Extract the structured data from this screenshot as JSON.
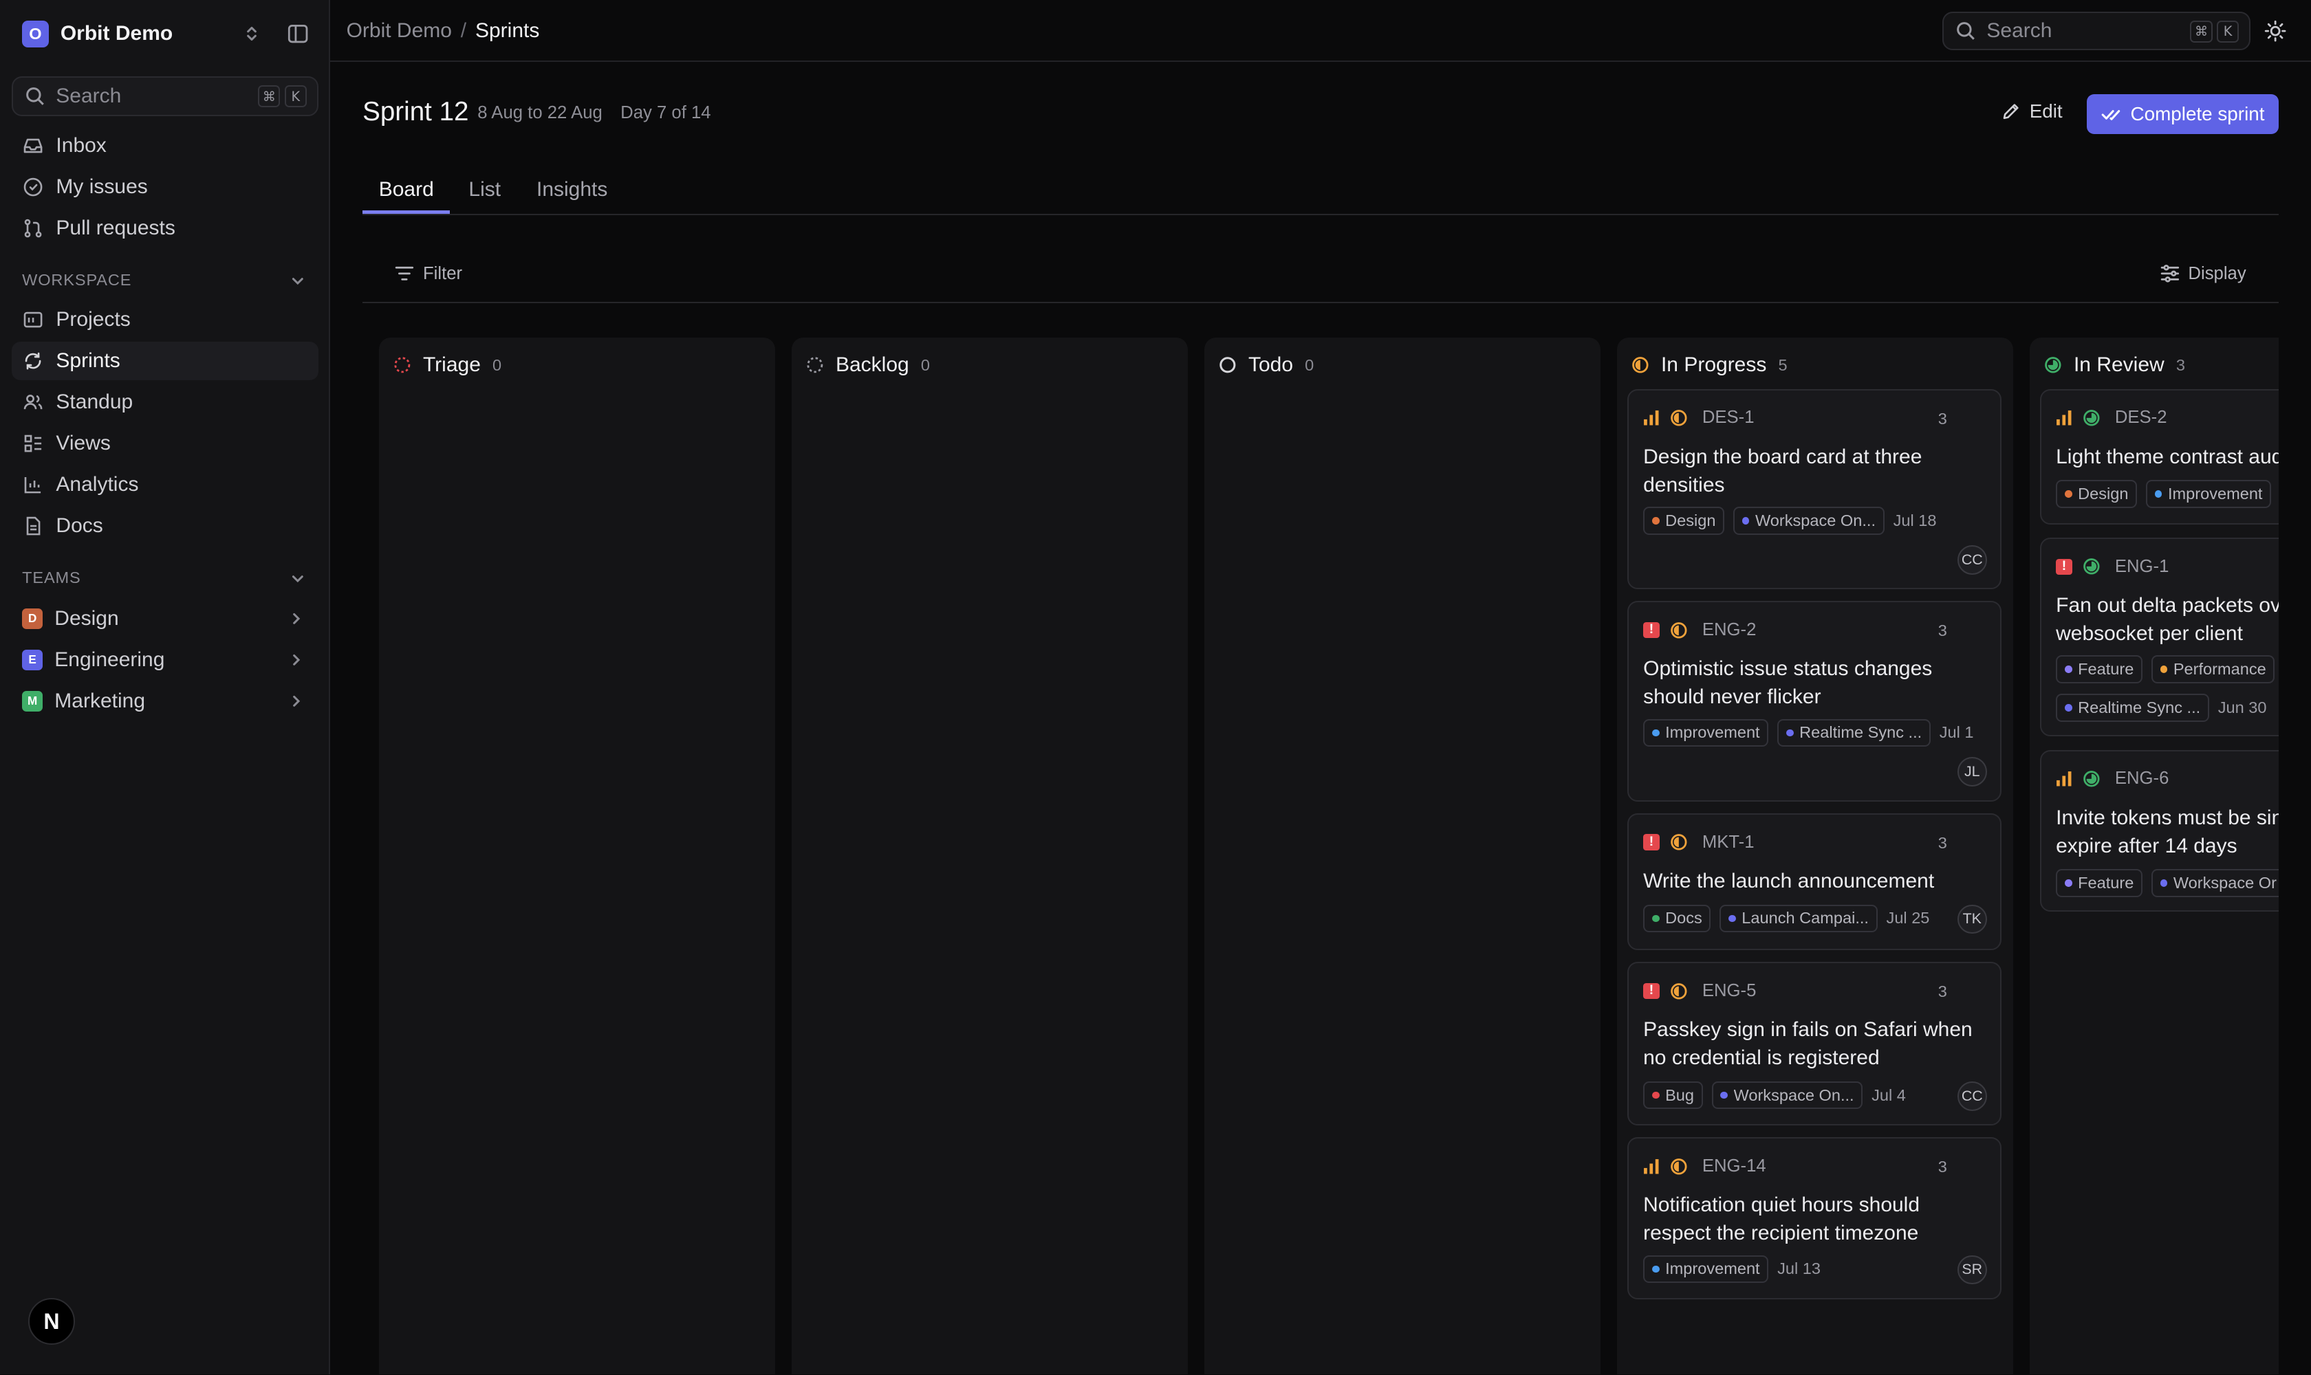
{
  "workspace": {
    "name": "Orbit Demo",
    "logo_letter": "O"
  },
  "sidebar": {
    "search_placeholder": "Search",
    "shortcut": [
      "⌘",
      "K"
    ],
    "nav": [
      {
        "label": "Inbox",
        "icon": "inbox-icon"
      },
      {
        "label": "My issues",
        "icon": "my-issues-icon"
      },
      {
        "label": "Pull requests",
        "icon": "pull-request-icon"
      }
    ],
    "workspace_section": "WORKSPACE",
    "workspace_items": [
      {
        "label": "Projects",
        "icon": "projects-icon"
      },
      {
        "label": "Sprints",
        "icon": "sprints-icon",
        "active": true
      },
      {
        "label": "Standup",
        "icon": "standup-icon"
      },
      {
        "label": "Views",
        "icon": "views-icon"
      },
      {
        "label": "Analytics",
        "icon": "analytics-icon"
      },
      {
        "label": "Docs",
        "icon": "docs-icon"
      }
    ],
    "teams_section": "TEAMS",
    "teams": [
      {
        "label": "Design",
        "letter": "D",
        "color": "#c4623d"
      },
      {
        "label": "Engineering",
        "letter": "E",
        "color": "#5f63e6"
      },
      {
        "label": "Marketing",
        "letter": "M",
        "color": "#3fae68"
      }
    ],
    "user_avatar": "N"
  },
  "topbar": {
    "breadcrumb_root": "Orbit Demo",
    "breadcrumb_sep": "/",
    "breadcrumb_current": "Sprints",
    "search_placeholder": "Search",
    "shortcut": [
      "⌘",
      "K"
    ]
  },
  "sprint": {
    "title": "Sprint 12",
    "dates": "8 Aug to 22 Aug",
    "day": "Day 7 of 14",
    "edit_label": "Edit",
    "complete_label": "Complete sprint"
  },
  "tabs": [
    "Board",
    "List",
    "Insights"
  ],
  "toolbar": {
    "filter_label": "Filter",
    "display_label": "Display"
  },
  "colors": {
    "accent": "#5f63e6",
    "urgent": "#e5484d",
    "in_progress": "#f0a23b",
    "in_review": "#3fae68"
  },
  "columns": [
    {
      "name": "Triage",
      "count": "0",
      "status": "triage",
      "cards": []
    },
    {
      "name": "Backlog",
      "count": "0",
      "status": "backlog",
      "cards": []
    },
    {
      "name": "Todo",
      "count": "0",
      "status": "todo",
      "cards": []
    },
    {
      "name": "In Progress",
      "count": "5",
      "status": "in-progress",
      "cards": [
        {
          "id": "DES-1",
          "priority": "medium",
          "estimate": "3",
          "title": "Design the board card at three densities",
          "labels": [
            {
              "text": "Design",
              "color": "#e0743d"
            }
          ],
          "project": {
            "text": "Workspace On...",
            "color": "#6b6ef0"
          },
          "due": "Jul 18",
          "assignee": "CC"
        },
        {
          "id": "ENG-2",
          "priority": "urgent",
          "estimate": "3",
          "title": "Optimistic issue status changes should never flicker",
          "labels": [
            {
              "text": "Improvement",
              "color": "#4a9cf0"
            }
          ],
          "project": {
            "text": "Realtime Sync ...",
            "color": "#6b6ef0"
          },
          "due": "Jul 1",
          "assignee": "JL"
        },
        {
          "id": "MKT-1",
          "priority": "urgent",
          "estimate": "3",
          "title": "Write the launch announcement",
          "labels": [
            {
              "text": "Docs",
              "color": "#3fae68"
            }
          ],
          "project": {
            "text": "Launch Campai...",
            "color": "#6b6ef0"
          },
          "due": "Jul 25",
          "assignee": "TK"
        },
        {
          "id": "ENG-5",
          "priority": "urgent",
          "estimate": "3",
          "title": "Passkey sign in fails on Safari when no credential is registered",
          "labels": [
            {
              "text": "Bug",
              "color": "#e5484d"
            }
          ],
          "project": {
            "text": "Workspace On...",
            "color": "#6b6ef0"
          },
          "due": "Jul 4",
          "assignee": "CC"
        },
        {
          "id": "ENG-14",
          "priority": "medium",
          "estimate": "3",
          "title": "Notification quiet hours should respect the recipient timezone",
          "labels": [
            {
              "text": "Improvement",
              "color": "#4a9cf0"
            }
          ],
          "project": null,
          "due": "Jul 13",
          "assignee": "SR"
        }
      ]
    },
    {
      "name": "In Review",
      "count": "3",
      "status": "in-review",
      "cards": [
        {
          "id": "DES-2",
          "priority": "medium",
          "title": "Light theme contrast aud",
          "labels": [
            {
              "text": "Design",
              "color": "#e0743d"
            },
            {
              "text": "Improvement",
              "color": "#4a9cf0"
            }
          ]
        },
        {
          "id": "ENG-1",
          "priority": "urgent",
          "title": "Fan out delta packets ov websocket per client",
          "labels": [
            {
              "text": "Feature",
              "color": "#8b7cf6"
            },
            {
              "text": "Performance",
              "color": "#f0a23b"
            }
          ],
          "project": {
            "text": "Realtime Sync ...",
            "color": "#6b6ef0"
          },
          "due": "Jun 30"
        },
        {
          "id": "ENG-6",
          "priority": "medium",
          "title": "Invite tokens must be sin expire after 14 days",
          "labels": [
            {
              "text": "Feature",
              "color": "#8b7cf6"
            },
            {
              "text": "Workspace Or",
              "color": "#6b6ef0"
            }
          ]
        }
      ]
    }
  ]
}
